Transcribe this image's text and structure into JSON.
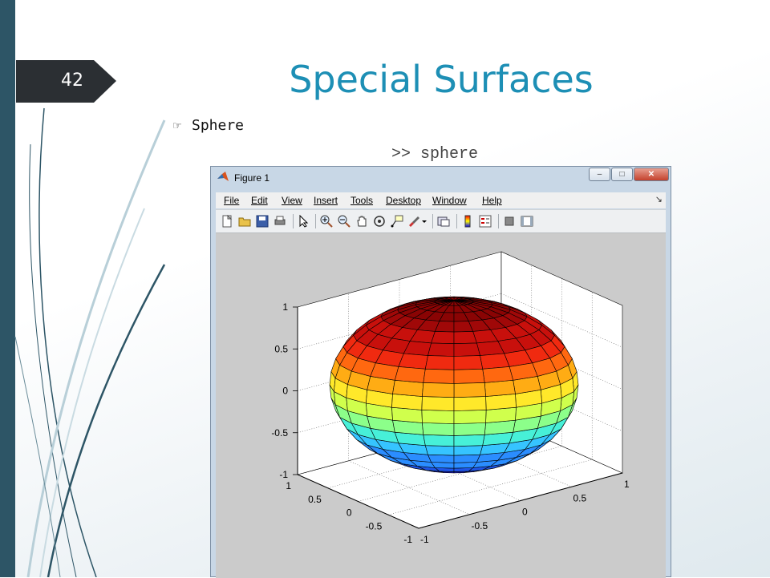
{
  "slide": {
    "number": "42",
    "title": "Special Surfaces",
    "bullet_icon": "hand-pointer-icon",
    "bullet_text": "Sphere",
    "command": ">> sphere"
  },
  "window": {
    "title": "Figure 1",
    "app_icon": "matlab-logo-icon",
    "minimize_label": "–",
    "maximize_label": "□",
    "close_label": "✕"
  },
  "menu": {
    "items": [
      "File",
      "Edit",
      "View",
      "Insert",
      "Tools",
      "Desktop",
      "Window",
      "Help"
    ],
    "overflow": "↘"
  },
  "toolbar": {
    "icons": [
      "new-figure-icon",
      "open-file-icon",
      "save-icon",
      "print-icon",
      "edit-plot-icon",
      "zoom-in-icon",
      "zoom-out-icon",
      "pan-icon",
      "rotate-3d-icon",
      "data-cursor-icon",
      "brush-icon",
      "link-plot-icon",
      "colorbar-icon",
      "legend-icon",
      "hide-plot-tools-icon",
      "show-plot-tools-icon"
    ]
  },
  "colors": {
    "accent": "#1d8fb5",
    "sidebar": "#2d5566",
    "plot_background": "#cbcbcb"
  },
  "chart_data": {
    "type": "surface",
    "function": "sphere",
    "grid": true,
    "colormap": "jet",
    "z_ticks": [
      "1",
      "0.5",
      "0",
      "-0.5",
      "-1"
    ],
    "y_ticks": [
      "1",
      "0.5",
      "0",
      "-0.5",
      "-1"
    ],
    "x_ticks": [
      "1",
      "0.5",
      "0",
      "-0.5",
      "-1"
    ],
    "xlim": [
      -1,
      1
    ],
    "ylim": [
      -1,
      1
    ],
    "zlim": [
      -1,
      1
    ]
  }
}
